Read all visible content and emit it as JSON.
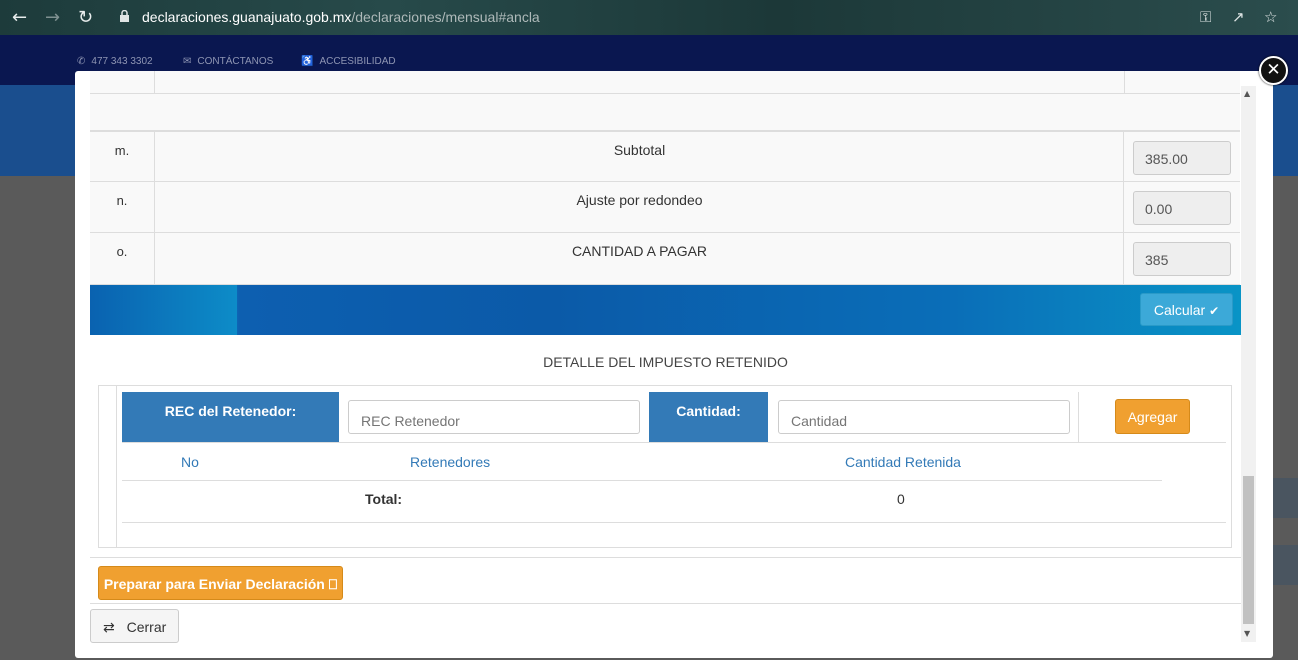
{
  "browser": {
    "url_domain": "declaraciones.guanajuato.gob.mx",
    "url_path": "/declaraciones/mensual#ancla"
  },
  "site": {
    "phone": "477 343 3302",
    "contact": "CONTÁCTANOS",
    "accessibility": "ACCESIBILIDAD"
  },
  "summary_rows": [
    {
      "letter": "m.",
      "label": "Subtotal",
      "value": "385.00"
    },
    {
      "letter": "n.",
      "label": "Ajuste por redondeo",
      "value": "0.00"
    },
    {
      "letter": "o.",
      "label": "CANTIDAD A PAGAR",
      "value": "385"
    }
  ],
  "calc_button": "Calcular",
  "detail": {
    "title": "DETALLE DEL IMPUESTO RETENIDO",
    "rec_label": "REC del Retenedor:",
    "rec_placeholder": "REC Retenedor",
    "cantidad_label": "Cantidad:",
    "cantidad_placeholder": "Cantidad",
    "add_button": "Agregar",
    "columns": [
      "No",
      "Retenedores",
      "Cantidad Retenida"
    ],
    "total_label": "Total:",
    "total_value": "0"
  },
  "footer": {
    "prepare_button": "Preparar para Enviar Declaración",
    "close_button": "Cerrar"
  },
  "colors": {
    "primary_blue": "#337ab7",
    "orange": "#f0a030",
    "calc_blue": "#3ca9d8"
  }
}
